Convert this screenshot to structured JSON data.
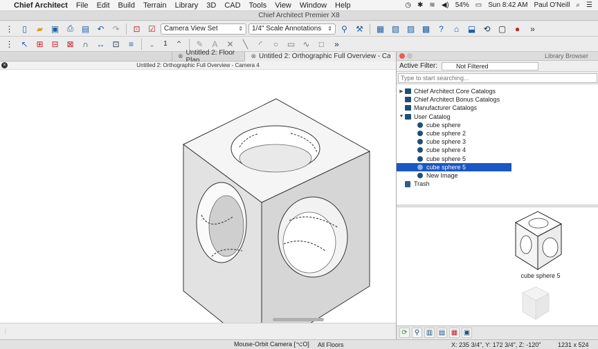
{
  "menubar": {
    "app_name": "Chief Architect",
    "menus": [
      "File",
      "Edit",
      "Build",
      "Terrain",
      "Library",
      "3D",
      "CAD",
      "Tools",
      "View",
      "Window",
      "Help"
    ],
    "battery": "54%",
    "clock": "Sun 8:42 AM",
    "user": "Paul O'Neill"
  },
  "window": {
    "title": "Chief Architect Premier X8"
  },
  "toolbar": {
    "view_set": "Camera View Set",
    "annotation_set": "1/4\" Scale Annotations",
    "layer_number": "1"
  },
  "tabs": [
    {
      "label": "Untitled 2: Floor Plan",
      "active": false
    },
    {
      "label": "Untitled 2: Orthographic Full Overview - Camera 4",
      "active": true
    }
  ],
  "view": {
    "header": "Untitled 2: Orthographic Full Overview - Camera 4"
  },
  "library": {
    "title": "Library Browser",
    "filter_label": "Active Filter:",
    "filter_value": "Not Filtered",
    "search_placeholder": "Type to start searching...",
    "tree": [
      {
        "label": "Chief Architect Core Catalogs",
        "type": "folder",
        "depth": 0,
        "expanded": false
      },
      {
        "label": "Chief Architect Bonus Catalogs",
        "type": "folder",
        "depth": 0,
        "expanded": false
      },
      {
        "label": "Manufacturer Catalogs",
        "type": "folder",
        "depth": 0,
        "expanded": false
      },
      {
        "label": "User Catalog",
        "type": "folder",
        "depth": 0,
        "expanded": true
      },
      {
        "label": "cube sphere",
        "type": "item",
        "depth": 1
      },
      {
        "label": "cube sphere 2",
        "type": "item",
        "depth": 1
      },
      {
        "label": "cube sphere 3",
        "type": "item",
        "depth": 1
      },
      {
        "label": "cube sphere 4",
        "type": "item",
        "depth": 1
      },
      {
        "label": "cube sphere 5",
        "type": "item",
        "depth": 1
      },
      {
        "label": "cube sphere 5",
        "type": "item",
        "depth": 1,
        "selected": true
      },
      {
        "label": "New Image",
        "type": "item",
        "depth": 1
      },
      {
        "label": "Trash",
        "type": "trash",
        "depth": 0
      }
    ],
    "preview_caption": "cube sphere 5"
  },
  "status": {
    "mode": "Mouse-Orbit Camera [⌥O]",
    "floors": "All Floors",
    "coords": "X: 235 3/4\", Y: 172 3/4\", Z: -120\"",
    "size": "1231 x 524"
  },
  "colors": {
    "selection": "#1a56c4",
    "folder_icon": "#1d4f7a",
    "close_light": "#ee5b52",
    "minimize_light": "#c4c4c4"
  }
}
